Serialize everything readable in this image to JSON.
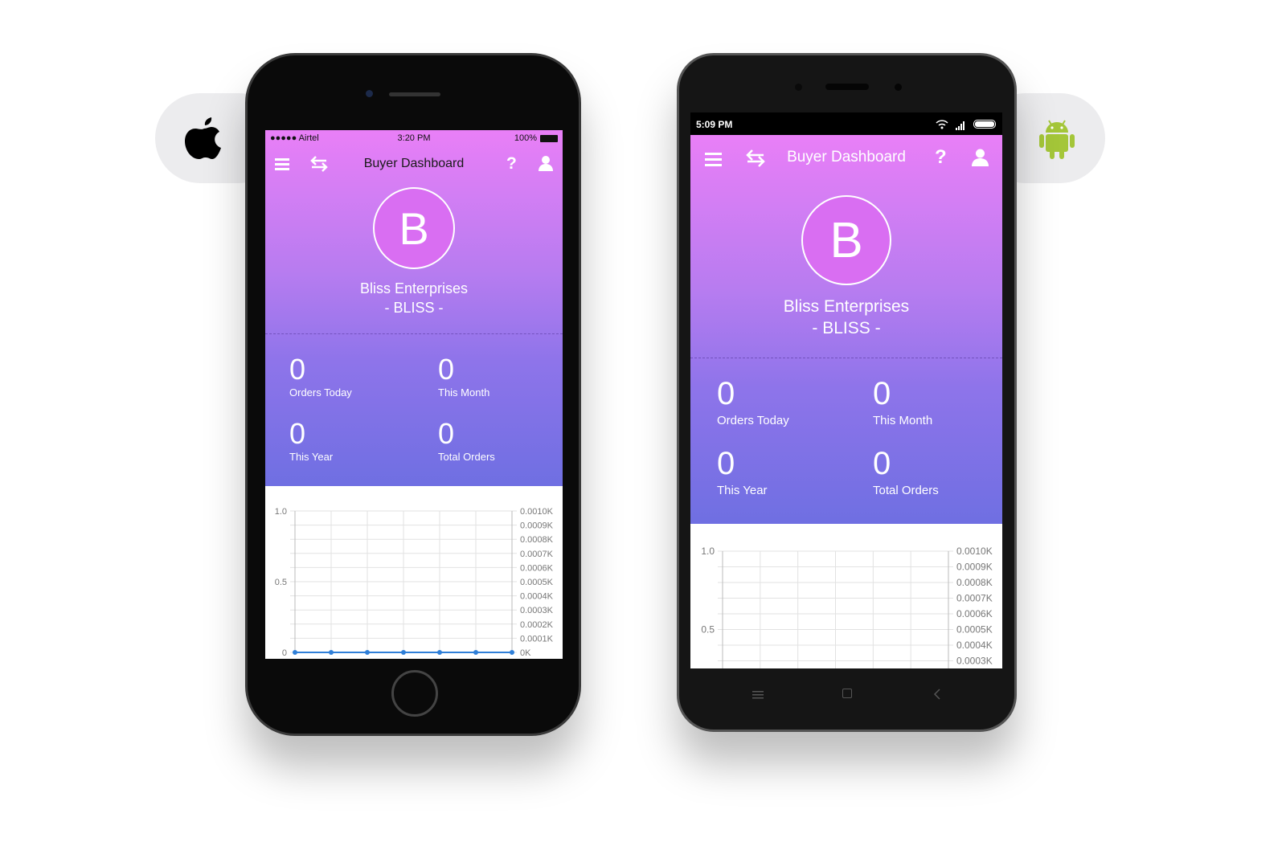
{
  "platforms": {
    "ios_icon": "apple-logo-icon",
    "android_icon": "android-robot-icon",
    "android_color": "#a4c639"
  },
  "ios": {
    "status": {
      "carrier": "●●●●● Airtel",
      "time": "3:20 PM",
      "battery": "100%"
    },
    "header": {
      "title": "Buyer Dashboard"
    },
    "profile": {
      "initial": "B",
      "name": "Bliss Enterprises",
      "code": "- BLISS -"
    },
    "stats": [
      {
        "value": "0",
        "label": "Orders Today"
      },
      {
        "value": "0",
        "label": "This Month"
      },
      {
        "value": "0",
        "label": "This Year"
      },
      {
        "value": "0",
        "label": "Total Orders"
      }
    ]
  },
  "android": {
    "status": {
      "time": "5:09 PM"
    },
    "header": {
      "title": "Buyer Dashboard"
    },
    "profile": {
      "initial": "B",
      "name": "Bliss Enterprises",
      "code": "- BLISS -"
    },
    "stats": [
      {
        "value": "0",
        "label": "Orders Today"
      },
      {
        "value": "0",
        "label": "This Month"
      },
      {
        "value": "0",
        "label": "This Year"
      },
      {
        "value": "0",
        "label": "Total Orders"
      }
    ],
    "nav": [
      "menu-icon",
      "home-square-icon",
      "back-chevron-icon"
    ]
  },
  "colors": {
    "gradient_top": "#e97ff7",
    "gradient_bottom": "#6f6fe2",
    "line": "#2f7fd8"
  },
  "chart_data": {
    "type": "line",
    "x": [
      1,
      2,
      3,
      4,
      5,
      6,
      7
    ],
    "values": [
      0,
      0,
      0,
      0,
      0,
      0,
      0
    ],
    "left_axis": {
      "ticks": [
        "0",
        "0.5",
        "1.0"
      ],
      "ylim": [
        0,
        1
      ]
    },
    "right_axis": {
      "ticks": [
        "0K",
        "0.0001K",
        "0.0002K",
        "0.0003K",
        "0.0004K",
        "0.0005K",
        "0.0006K",
        "0.0007K",
        "0.0008K",
        "0.0009K",
        "0.0010K"
      ],
      "ylim": [
        0,
        0.001
      ]
    },
    "grid": true
  }
}
